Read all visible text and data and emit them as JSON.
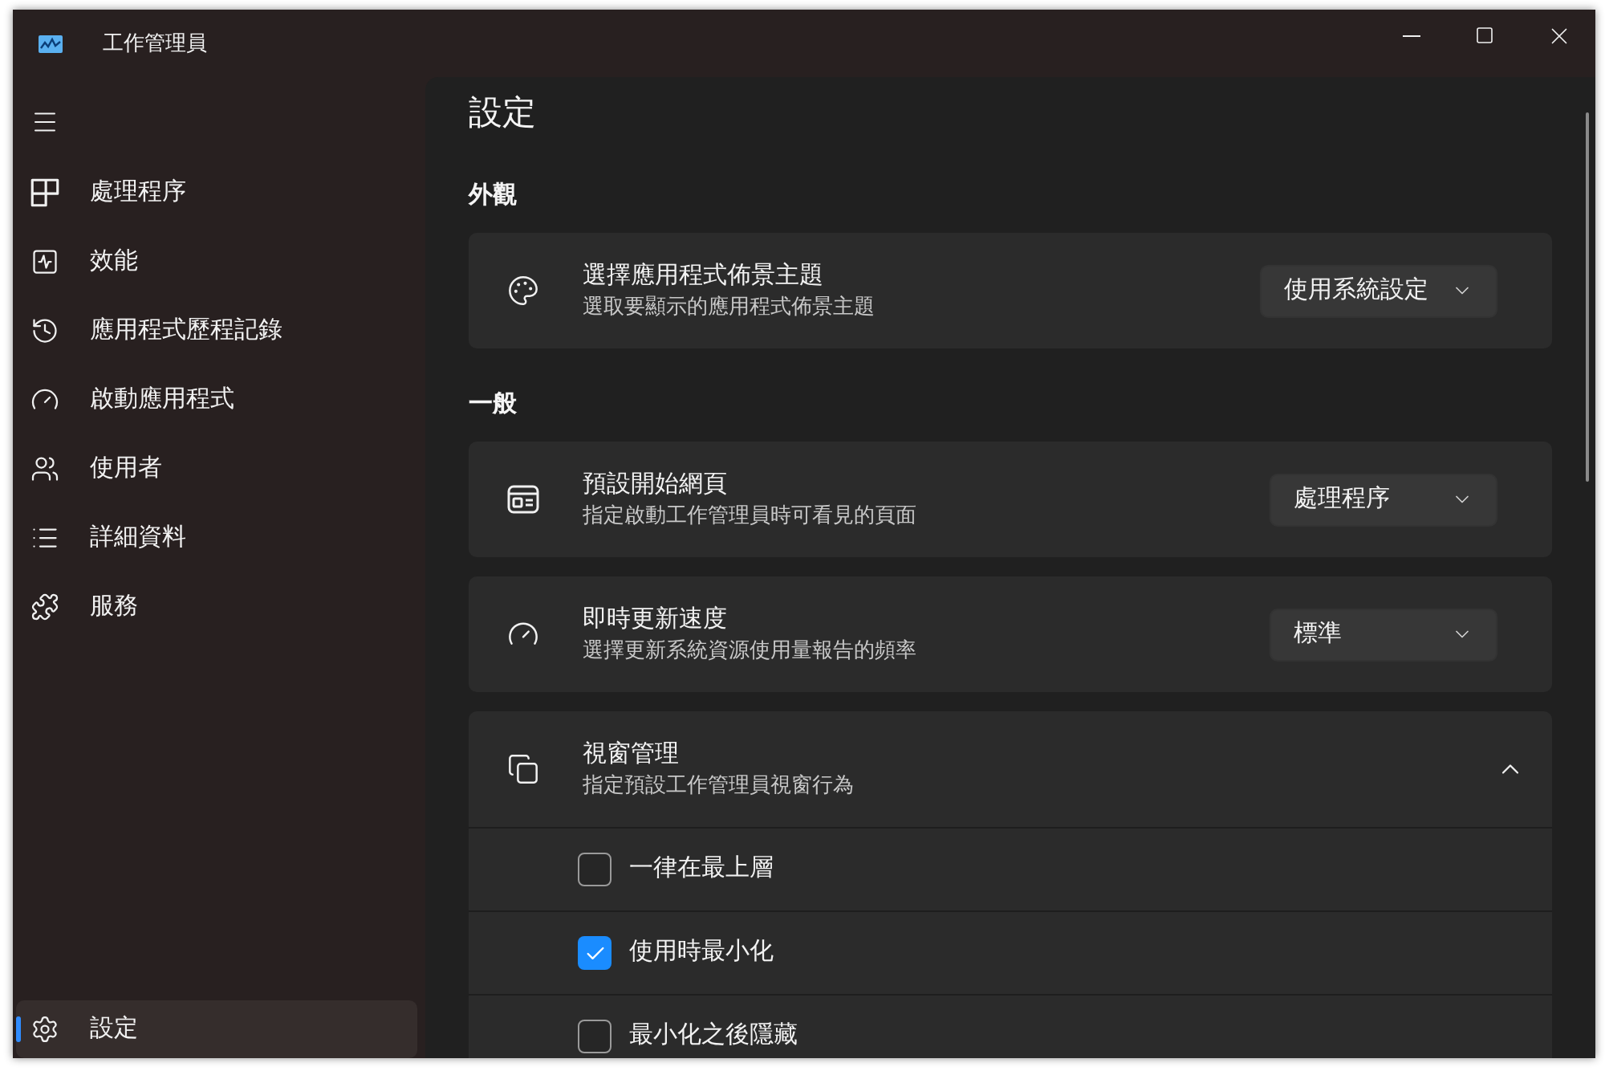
{
  "window": {
    "title": "工作管理員"
  },
  "sidebar": {
    "items": [
      {
        "label": "處理程序",
        "selected": false
      },
      {
        "label": "效能",
        "selected": false
      },
      {
        "label": "應用程式歷程記錄",
        "selected": false
      },
      {
        "label": "啟動應用程式",
        "selected": false
      },
      {
        "label": "使用者",
        "selected": false
      },
      {
        "label": "詳細資料",
        "selected": false
      },
      {
        "label": "服務",
        "selected": false
      }
    ],
    "footer_items": [
      {
        "label": "設定",
        "selected": true
      }
    ]
  },
  "page": {
    "title": "設定",
    "sections": [
      {
        "heading": "外觀",
        "cards": [
          {
            "kind": "dropdown",
            "title": "選擇應用程式佈景主題",
            "subtitle": "選取要顯示的應用程式佈景主題",
            "value": "使用系統設定"
          }
        ]
      },
      {
        "heading": "一般",
        "cards": [
          {
            "kind": "dropdown",
            "title": "預設開始網頁",
            "subtitle": "指定啟動工作管理員時可看見的頁面",
            "value": "處理程序"
          },
          {
            "kind": "dropdown",
            "title": "即時更新速度",
            "subtitle": "選擇更新系統資源使用量報告的頻率",
            "value": "標準"
          },
          {
            "kind": "expander",
            "title": "視窗管理",
            "subtitle": "指定預設工作管理員視窗行為",
            "expanded": true,
            "options": [
              {
                "label": "一律在最上層",
                "checked": false
              },
              {
                "label": "使用時最小化",
                "checked": true
              },
              {
                "label": "最小化之後隱藏",
                "checked": false
              }
            ]
          }
        ]
      }
    ]
  }
}
